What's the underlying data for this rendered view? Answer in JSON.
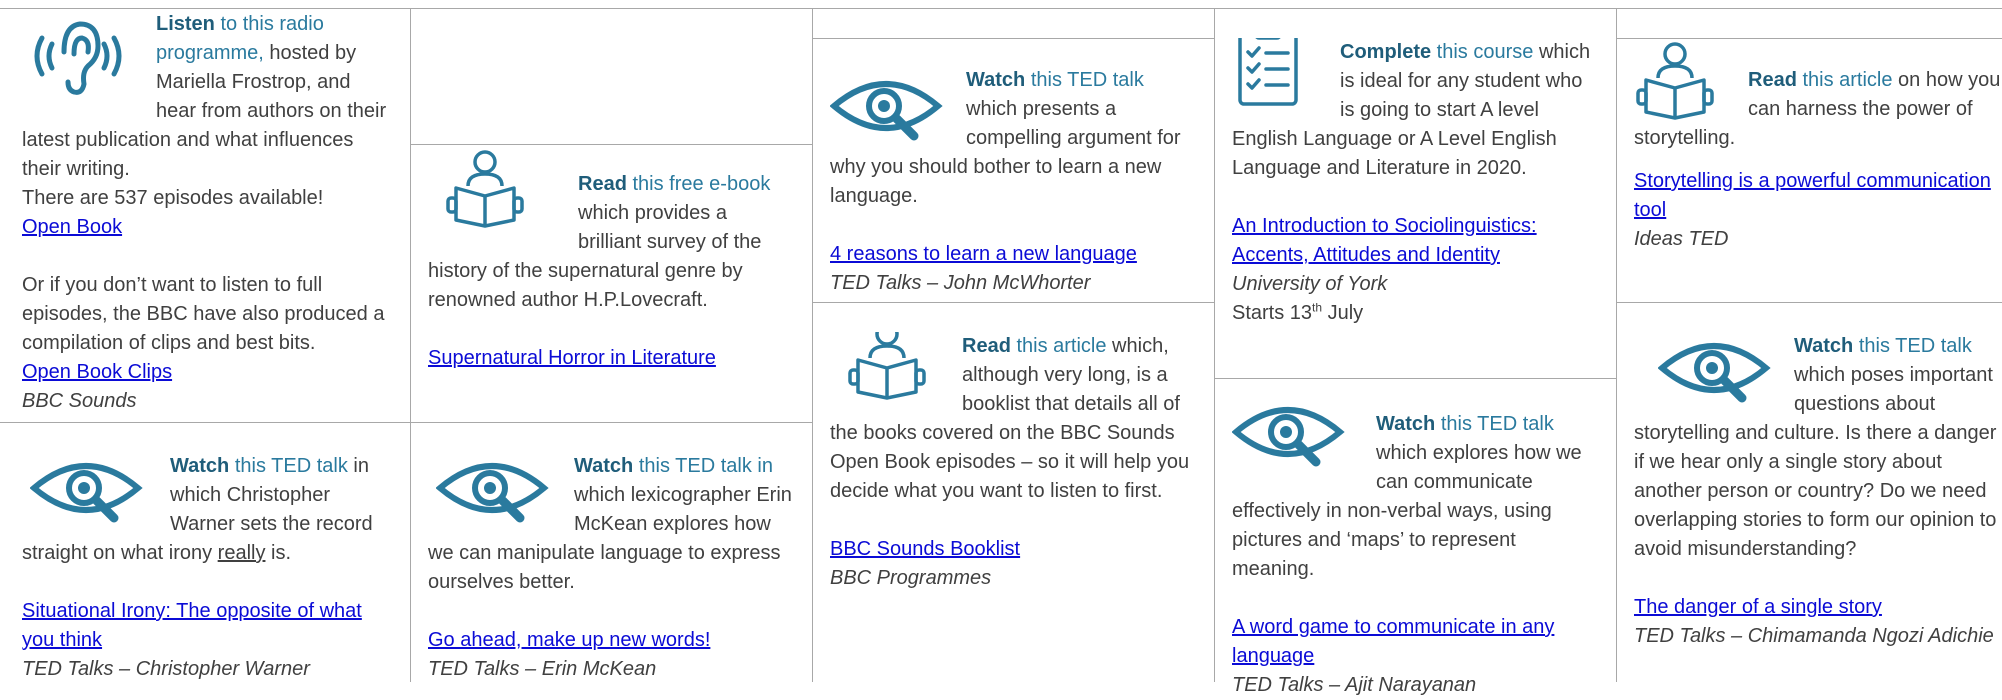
{
  "c1": {
    "lead": "Listen",
    "accent": " to this radio programme,",
    "rest": " hosted by Mariella Frostrop, and hear from authors on their latest publication and what influences their writing.",
    "extra": "There are 537 episodes available!",
    "link1": "Open Book",
    "para2": "Or if you don’t want to listen to full episodes, the BBC have also produced a compilation of clips and best bits.",
    "link2": "Open Book Clips",
    "src": "BBC Sounds"
  },
  "c2": {
    "lead": "Read",
    "accent": " this free e-book",
    "rest": " which provides a brilliant survey of the history of the supernatural genre by renowned author H.P.Lovecraft.",
    "link": "Supernatural Horror in Literature"
  },
  "c3": {
    "lead": "Watch",
    "accent": " this TED talk",
    "rest": " which presents a compelling argument for why you should bother to learn a new language.",
    "link": "4 reasons to learn a new language",
    "src": "TED Talks – John McWhorter"
  },
  "c4": {
    "lead": "Read",
    "accent": " this article",
    "rest": " which, although very long, is a booklist that details all of the books covered on the BBC Sounds Open Book episodes – so it will help you decide what you want to listen to first.",
    "link": "BBC Sounds Booklist",
    "src": "BBC Programmes"
  },
  "c5": {
    "lead": "Complete",
    "accent": " this course",
    "rest": " which is ideal for any student who is going to start A level English Language or A Level English Language and Literature in 2020.",
    "link": "An Introduction to Sociolinguistics: Accents, Attitudes and Identity",
    "src": "University of York",
    "starts_pre": "Starts 13",
    "starts_sup": "th",
    "starts_post": " July"
  },
  "c6": {
    "lead": "Watch",
    "accent": " this TED talk",
    "rest": " which explores how we can communicate effectively in non-verbal ways, using pictures and ‘maps’ to represent meaning.",
    "link": "A word game to communicate in any language",
    "src": "TED Talks – Ajit Narayanan"
  },
  "c7": {
    "lead": "Read",
    "accent": " this article",
    "rest": " on how you can harness the power of storytelling.",
    "link": "Storytelling is a powerful communication tool",
    "src": "Ideas TED"
  },
  "c8": {
    "lead": "Watch",
    "accent": " this TED talk",
    "rest": " which poses important questions about storytelling and culture. Is there a danger if we hear only a single story about another person or country? Do we need overlapping stories to form our opinion to avoid misunderstanding?",
    "link": "The danger of a single story",
    "src": "TED Talks – Chimamanda Ngozi Adichie"
  },
  "c9": {
    "lead": "Watch",
    "accent": " this TED talk",
    "rest1": " in which Christopher Warner sets the record straight on what irony ",
    "emph": "really",
    "rest2": " is.",
    "link": "Situational Irony: The opposite of what you think",
    "src": "TED Talks – Christopher Warner"
  },
  "c10": {
    "lead": "Watch",
    "accent": " this TED talk in",
    "rest": " which lexicographer Erin McKean explores how we can manipulate language to express ourselves better.",
    "link": "Go ahead, make up new words!",
    "src": "TED Talks – Erin McKean"
  },
  "colors": {
    "lead": "#1f5d7a",
    "accent": "#2a7a9e",
    "link": "#0b0bd6",
    "icon": "#2a7a9e",
    "border": "#a8a8a8"
  },
  "icons": [
    "ear-listen-icon",
    "book-reader-icon",
    "eye-magnifier-icon",
    "clipboard-checklist-icon"
  ]
}
